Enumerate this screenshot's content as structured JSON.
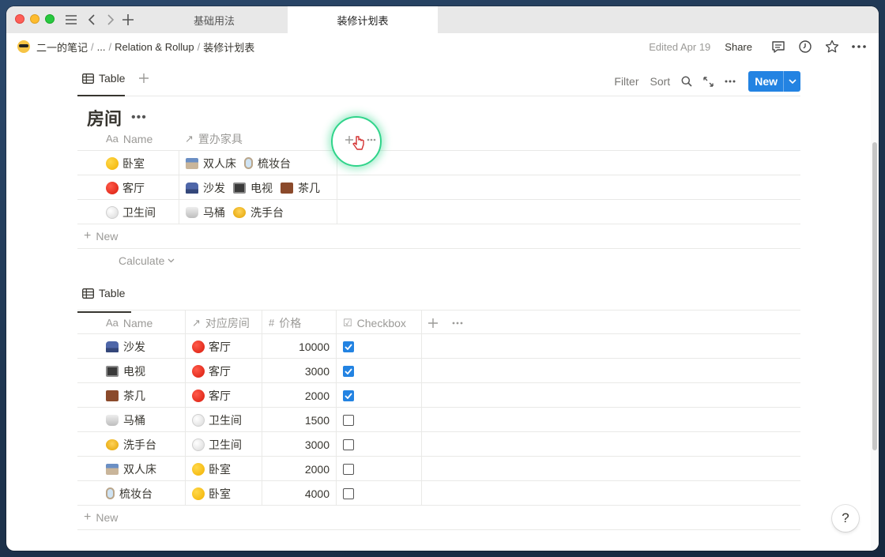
{
  "tabs": [
    {
      "label": "基础用法",
      "active": false
    },
    {
      "label": "装修计划表",
      "active": true
    }
  ],
  "breadcrumb": {
    "items": [
      "二一的笔记",
      "...",
      "Relation & Rollup",
      "装修计划表"
    ],
    "separator": "/"
  },
  "topbar": {
    "edited": "Edited Apr 19",
    "share": "Share"
  },
  "view1": {
    "tab_label": "Table",
    "filter": "Filter",
    "sort": "Sort",
    "new_label": "New"
  },
  "rooms": {
    "title": "房间",
    "columns": [
      "Name",
      "置办家具"
    ],
    "column_icons": [
      "Aa",
      "↗"
    ],
    "rows": [
      {
        "name": "卧室",
        "dot": "yellow",
        "items": [
          {
            "icon": "bed",
            "label": "双人床"
          },
          {
            "icon": "mirror",
            "label": "梳妆台"
          }
        ]
      },
      {
        "name": "客厅",
        "dot": "red",
        "items": [
          {
            "icon": "sofa",
            "label": "沙发"
          },
          {
            "icon": "tv",
            "label": "电视"
          },
          {
            "icon": "table",
            "label": "茶几"
          }
        ]
      },
      {
        "name": "卫生间",
        "dot": "white",
        "items": [
          {
            "icon": "toilet",
            "label": "马桶"
          },
          {
            "icon": "sink",
            "label": "洗手台"
          }
        ]
      }
    ],
    "new_label": "New",
    "calculate": "Calculate"
  },
  "view2": {
    "tab_label": "Table"
  },
  "furniture": {
    "columns": [
      "Name",
      "对应房间",
      "价格",
      "Checkbox"
    ],
    "column_icons": [
      "Aa",
      "↗",
      "#",
      "☑"
    ],
    "rows": [
      {
        "icon": "sofa",
        "name": "沙发",
        "room": "客厅",
        "dot": "red",
        "price": "10000",
        "checked": true
      },
      {
        "icon": "tv",
        "name": "电视",
        "room": "客厅",
        "dot": "red",
        "price": "3000",
        "checked": true
      },
      {
        "icon": "table",
        "name": "茶几",
        "room": "客厅",
        "dot": "red",
        "price": "2000",
        "checked": true
      },
      {
        "icon": "toilet",
        "name": "马桶",
        "room": "卫生间",
        "dot": "white",
        "price": "1500",
        "checked": false
      },
      {
        "icon": "sink",
        "name": "洗手台",
        "room": "卫生间",
        "dot": "white",
        "price": "3000",
        "checked": false
      },
      {
        "icon": "bed",
        "name": "双人床",
        "room": "卧室",
        "dot": "yellow",
        "price": "2000",
        "checked": false
      },
      {
        "icon": "mirror",
        "name": "梳妆台",
        "room": "卧室",
        "dot": "yellow",
        "price": "4000",
        "checked": false
      }
    ],
    "new_label": "New"
  },
  "help_label": "?",
  "colors": {
    "accent": "#2383e2",
    "highlight": "#2fd48a"
  }
}
